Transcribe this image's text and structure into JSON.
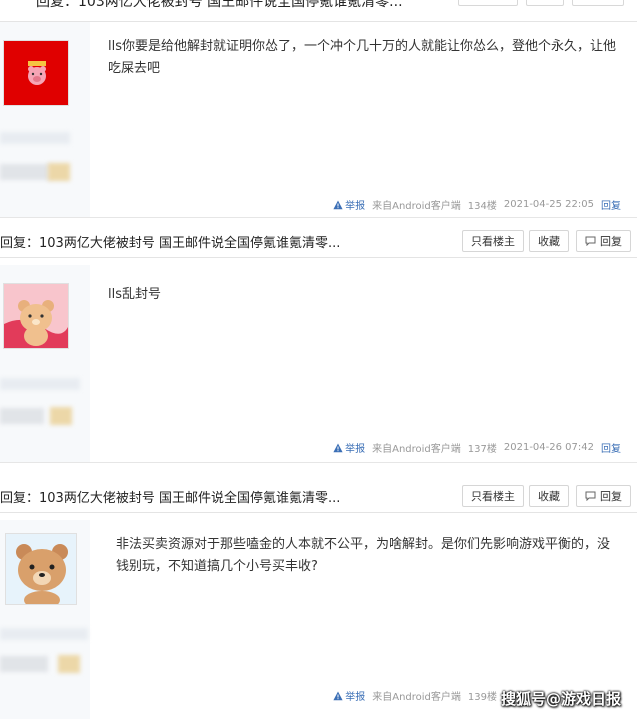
{
  "posts": [
    {
      "text": "lls你要是给他解封就证明你怂了，一个冲个几十万的人就能让你怂么，登他个永久，让他吃屎去吧",
      "report": "举报",
      "source": "来自Android客户端",
      "floor": "134楼",
      "time": "2021-04-25 22:05",
      "reply": "回复"
    },
    {
      "text": "lls乱封号",
      "report": "举报",
      "source": "来自Android客户端",
      "floor": "137楼",
      "time": "2021-04-26 07:42",
      "reply": "回复"
    },
    {
      "text": "非法买卖资源对于那些嗑金的人本就不公平，为啥解封。是你们先影响游戏平衡的，没钱别玩，不知道搞几个小号买丰收?",
      "report": "举报",
      "source": "来自Android客户端",
      "floor": "139楼",
      "time": "",
      "reply": ""
    }
  ],
  "reply_bar": {
    "title": "回复：103两亿大佬被封号 国王邮件说全国停氪谁氪清零...",
    "only_author": "只看楼主",
    "favorite": "收藏",
    "reply": "回复"
  },
  "watermark": "搜狐号@游戏日报",
  "colors": {
    "link": "#3b6fb6",
    "meta": "#999999",
    "avatar1_bg": "#e00000",
    "side_bg": "#f7f9fb"
  },
  "icons": [
    "warning-icon",
    "reply-bubble-icon"
  ]
}
